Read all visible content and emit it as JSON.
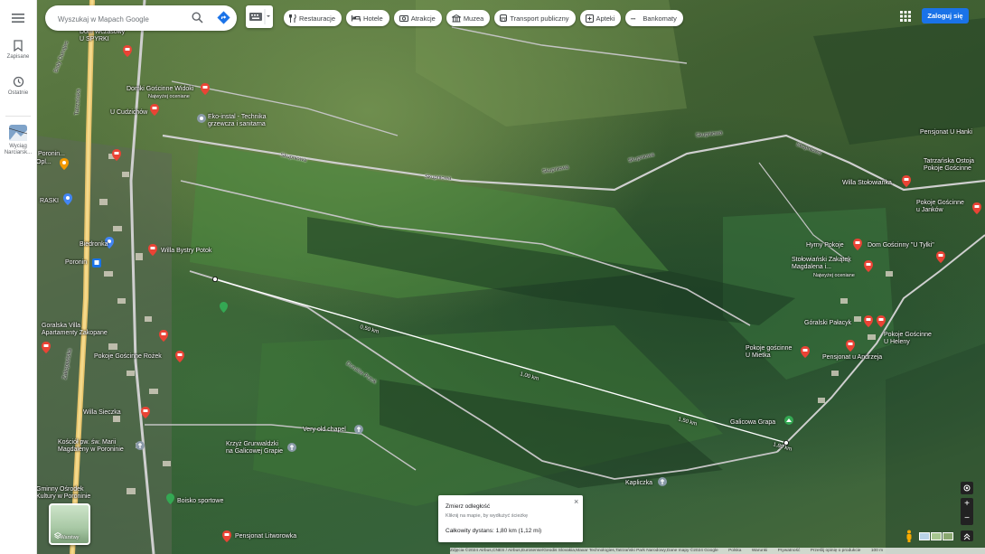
{
  "search": {
    "placeholder": "Wyszukaj w Mapach Google"
  },
  "rail": {
    "saved_label": "Zapisane",
    "recent_label": "Ostatnie",
    "place_label": "Wyciąg Narciarsk..."
  },
  "chips": [
    {
      "label": "Restauracje",
      "icon": "fork-knife-icon"
    },
    {
      "label": "Hotele",
      "icon": "bed-icon"
    },
    {
      "label": "Atrakcje",
      "icon": "camera-icon"
    },
    {
      "label": "Muzea",
      "icon": "museum-icon"
    },
    {
      "label": "Transport publiczny",
      "icon": "bus-icon"
    },
    {
      "label": "Apteki",
      "icon": "pharmacy-icon"
    },
    {
      "label": "Bankomaty",
      "icon": "atm-icon"
    }
  ],
  "login_label": "Zaloguj się",
  "places": {
    "p1": "Dom Wczasowy\nU SPYRKI",
    "p2": "Domki Gościnne Widoki",
    "p2b": "Najwyżej oceniane",
    "p3": "U Cudzichów",
    "p4": "Eko-instal - Technika\ngrzewcza i sanitarna",
    "p5": "Willa Bystry Potok",
    "p6": "Goralska Villa\nApartamenty Zakopane",
    "p7": "Pokoje Gościnne Rożek",
    "p8": "Willa Sieczka",
    "p9": "Kościół pw. św. Marii\nMagdaleny w Poroninie",
    "p10": "Krzyż Grunwaldzki\nna Galicowej Grapie",
    "p11": "Very old chapel",
    "p12": "Boisko sportowe",
    "p13": "Pensjonat Litworowka",
    "p14": "Gminny Ośrodek\nKultury w Poroninie",
    "p15": "Kapliczka",
    "p16": "Galicowa Grapa",
    "p17": "Pokoje gościnne\nU Mietka",
    "p18": "Pensjonat u Andrzeja",
    "p19": "Góralski Pałacyk",
    "p20": "Pokoje Gościnne\nU Heleny",
    "p21": "Stołowiański Zakątek\nMagdalena i...",
    "p21b": "Najwyżej oceniane",
    "p22": "Hyrny Pokoje",
    "p23": "Dom Gościnny \"U Tylki\"",
    "p24": "Willa Stołowianka",
    "p25": "Pokoje Gościnne\nu Janków",
    "p26": "Tatrzańska Ostoja\nPokoje Gościnne",
    "p27": "Pensjonat U Hanki",
    "p28": "RASKI",
    "p29": "Biedronka",
    "p30": "Poronin",
    "p31": "Poronin...",
    "p32": "Opl..."
  },
  "roads": {
    "r1": "Skupniowa",
    "r2": "Skupniowa",
    "r3": "Skupniowa",
    "r4": "Skupniowa",
    "r5": "Skupniowa",
    "r6": "Skupniowa",
    "r7": "Dorulów Potok",
    "r8": "Tatrzańska",
    "r9": "Zakopiańska",
    "r10": "Biały Dunajec"
  },
  "distances": {
    "d1": "0,50 km",
    "d2": "1,00 km",
    "d3": "1,50 km",
    "d4": "1,80 km"
  },
  "measure": {
    "title": "Zmierz odległość",
    "hint": "Kliknij na mapie, by wydłużyć ścieżkę",
    "total": "Całkowity dystans: 1,80 km (1,12 mi)",
    "close": "×"
  },
  "layers_label": "Warstwy",
  "attribution": {
    "data": "Zdjęcia ©2024 Airbus,CNES / Airbus,Eurosense/Geodis Slovakia,Maxar Technologies,Tatrzański Park Narodowy,Dane mapy ©2024 Google",
    "country": "Polska",
    "terms": "Warunki",
    "privacy": "Prywatność",
    "report": "Prześlij opinię o produkcie",
    "scale": "100 m"
  },
  "controls": {
    "zoom_in": "+",
    "zoom_out": "−"
  },
  "colors": {
    "accent": "#1a73e8",
    "pin": "#ea4335",
    "road": "#c9c9c9",
    "measure_line": "#ffffff"
  }
}
